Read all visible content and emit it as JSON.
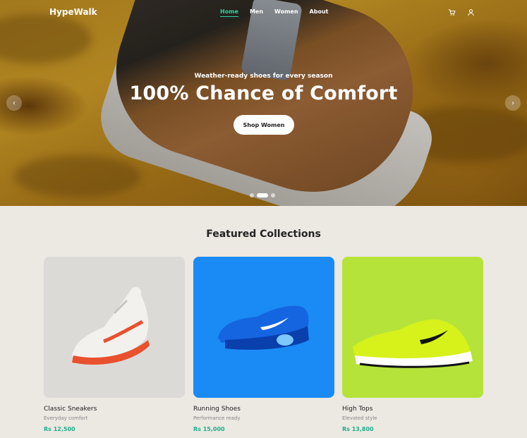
{
  "brand": "HypeWalk",
  "nav": {
    "links": [
      {
        "label": "Home",
        "active": true
      },
      {
        "label": "Men",
        "active": false
      },
      {
        "label": "Women",
        "active": false
      },
      {
        "label": "About",
        "active": false
      }
    ],
    "icons": [
      "cart-icon",
      "user-icon"
    ]
  },
  "hero": {
    "subtitle": "Weather-ready shoes for every season",
    "title": "100% Chance of Comfort",
    "button_label": "Shop Women",
    "slides": 3,
    "active_slide": 2
  },
  "featured": {
    "title": "Featured Collections",
    "items": [
      {
        "name": "Classic Sneakers",
        "desc": "Everyday comfort",
        "price": "Rs 12,500",
        "bg": "#dcdad7"
      },
      {
        "name": "Running Shoes",
        "desc": "Performance ready",
        "price": "Rs 15,000",
        "bg": "#1a8bf5"
      },
      {
        "name": "High Tops",
        "desc": "Elevated style",
        "price": "Rs 13,800",
        "bg": "#b5e33a"
      }
    ]
  },
  "colors": {
    "accent": "#2ed3a0",
    "price": "#1fae8a",
    "page_bg": "#ece8e2"
  }
}
